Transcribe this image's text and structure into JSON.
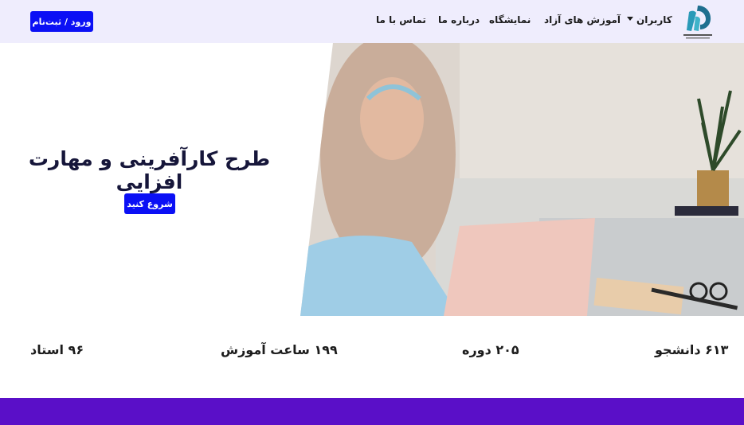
{
  "header": {
    "login_label": "ورود / ثبت‌نام",
    "nav": {
      "users": "کاربران",
      "free_courses": "آموزش های آزاد",
      "exhibition": "نمایشگاه",
      "about": "درباره ما",
      "contact": "تماس با ما"
    }
  },
  "hero": {
    "title": "طرح کارآفرینی و مهارت افزایی",
    "start_label": "شروع کنید"
  },
  "stats": {
    "students": "۶۱۳ دانشجو",
    "courses": "۲۰۵ دوره",
    "hours": "۱۹۹ ساعت آموزش",
    "teachers": "۹۶ استاد"
  },
  "colors": {
    "accent": "#0b10f5",
    "header_bg": "#efedfd",
    "band": "#5a0fc8"
  }
}
